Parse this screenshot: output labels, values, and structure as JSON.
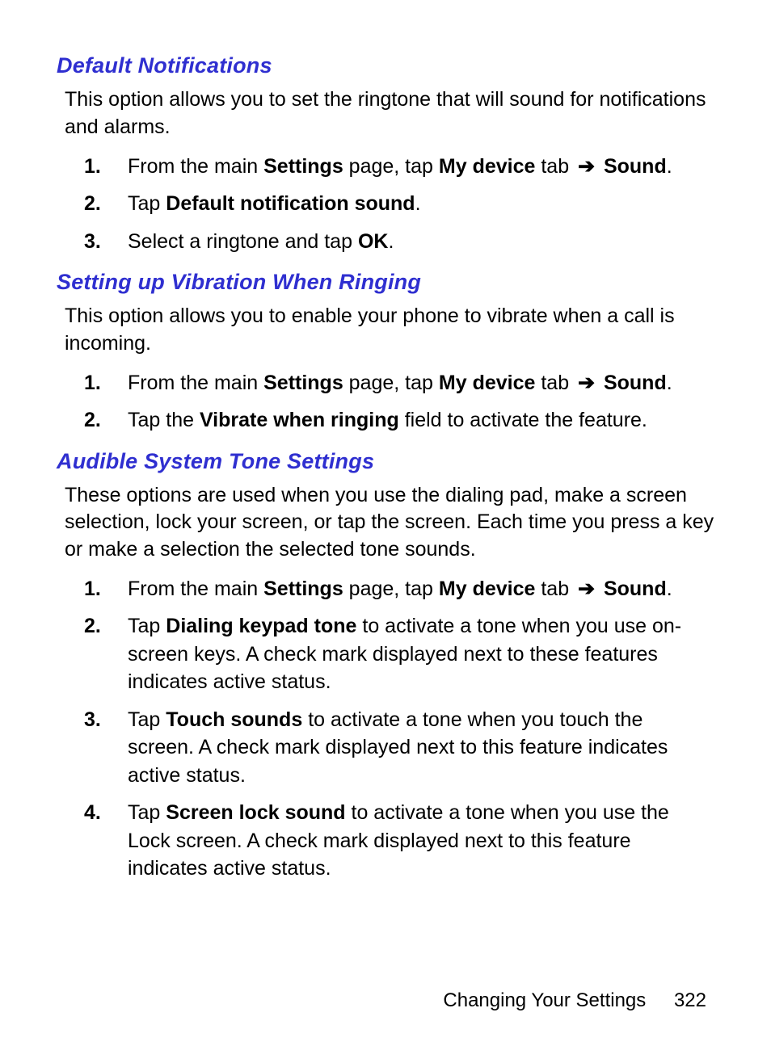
{
  "sections": [
    {
      "title": "Default Notifications",
      "intro": "This option allows you to set the ringtone that will sound for notifications and alarms.",
      "steps": [
        {
          "num": "1.",
          "parts": [
            "From the main ",
            {
              "b": "Settings"
            },
            " page, tap ",
            {
              "b": "My device"
            },
            " tab ",
            {
              "arrow": "➔"
            },
            " ",
            {
              "b": "Sound"
            },
            "."
          ]
        },
        {
          "num": "2.",
          "parts": [
            "Tap ",
            {
              "b": "Default notification sound"
            },
            "."
          ]
        },
        {
          "num": "3.",
          "parts": [
            "Select a ringtone and tap ",
            {
              "b": "OK"
            },
            "."
          ]
        }
      ]
    },
    {
      "title": "Setting up Vibration When Ringing",
      "intro": "This option allows you to enable your phone to vibrate when a call is incoming.",
      "steps": [
        {
          "num": "1.",
          "parts": [
            "From the main ",
            {
              "b": "Settings"
            },
            " page, tap ",
            {
              "b": "My device"
            },
            " tab ",
            {
              "arrow": "➔"
            },
            " ",
            {
              "b": "Sound"
            },
            "."
          ]
        },
        {
          "num": "2.",
          "parts": [
            "Tap the ",
            {
              "b": "Vibrate when ringing"
            },
            " field to activate the feature."
          ]
        }
      ]
    },
    {
      "title": "Audible System Tone Settings",
      "intro": "These options are used when you use the dialing pad, make a screen selection, lock your screen, or tap the screen. Each time you press a key or make a selection the selected tone sounds.",
      "steps": [
        {
          "num": "1.",
          "parts": [
            "From the main ",
            {
              "b": "Settings"
            },
            " page, tap ",
            {
              "b": "My device"
            },
            " tab ",
            {
              "arrow": "➔"
            },
            " ",
            {
              "b": "Sound"
            },
            "."
          ]
        },
        {
          "num": "2.",
          "parts": [
            "Tap ",
            {
              "b": "Dialing keypad tone"
            },
            " to activate a tone when you use on-screen keys. A check mark displayed next to these features indicates active status."
          ]
        },
        {
          "num": "3.",
          "parts": [
            "Tap ",
            {
              "b": "Touch sounds"
            },
            " to activate a tone when you touch the screen. A check mark displayed next to this feature indicates active status."
          ]
        },
        {
          "num": "4.",
          "parts": [
            "Tap ",
            {
              "b": "Screen lock sound"
            },
            " to activate a tone when you use the Lock screen. A check mark displayed next to this feature indicates active status."
          ]
        }
      ]
    }
  ],
  "footer": {
    "chapter": "Changing Your Settings",
    "page": "322"
  }
}
